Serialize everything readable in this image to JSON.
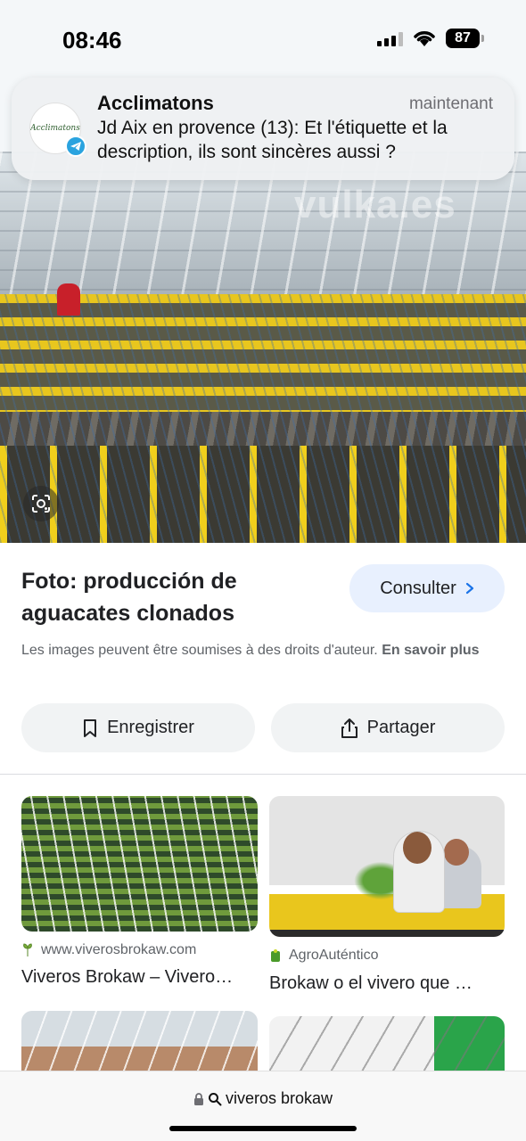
{
  "status_bar": {
    "time": "08:46",
    "battery": "87"
  },
  "notification": {
    "app": "Acclimatons",
    "icon_label": "Acclimatons",
    "time": "maintenant",
    "message": "Jd Aix en provence (13): Et l'étiquette et la description, ils sont sincères aussi ?"
  },
  "hero": {
    "watermark": "vulka.es"
  },
  "info": {
    "caption": "Foto: producción de aguacates clonados",
    "consult_label": "Consulter",
    "rights_text": "Les images peuvent être soumises à des droits d'auteur.",
    "rights_link": "En savoir plus"
  },
  "actions": {
    "save_label": "Enregistrer",
    "share_label": "Partager"
  },
  "results": [
    {
      "source": "www.viverosbrokaw.com",
      "title": "Viveros Brokaw – Vivero…"
    },
    {
      "source": "AgroAuténtico",
      "title": "Brokaw o el vivero que …"
    }
  ],
  "url_bar": {
    "query": "viveros brokaw"
  },
  "colors": {
    "consult_bg": "#e8f0fe",
    "telegram": "#2aa3df",
    "action_bg": "#f1f3f4"
  }
}
